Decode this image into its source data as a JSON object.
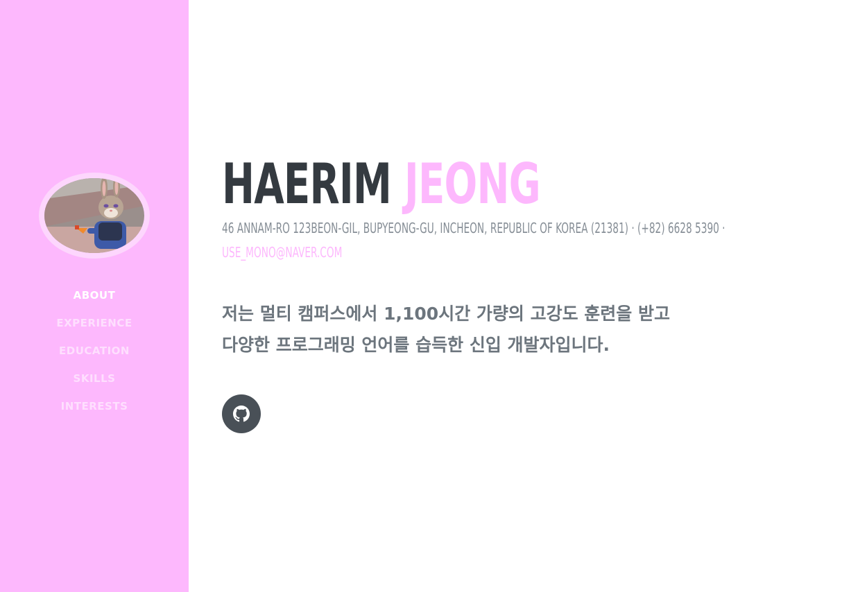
{
  "sidebar": {
    "bg_color": "#fdb8fd",
    "avatar_alt": "profile-photo",
    "nav": [
      {
        "label": "ABOUT",
        "active": true
      },
      {
        "label": "EXPERIENCE",
        "active": false
      },
      {
        "label": "EDUCATION",
        "active": false
      },
      {
        "label": "SKILLS",
        "active": false
      },
      {
        "label": "INTERESTS",
        "active": false
      }
    ]
  },
  "main": {
    "first_name": "HAERIM",
    "last_name": "JEONG",
    "address": "46 ANNAM-RO 123BEON-GIL, BUPYEONG-GU, INCHEON, REPUBLIC OF KOREA (21381) · (+82) 6628 5390 ·",
    "email": "USE_MONO@NAVER.COM",
    "intro_line1": "저는 멀티 캠퍼스에서 1,100시간 가량의 고강도 훈련을 받고",
    "intro_line2": "다양한 프로그래밍 언어를 습득한 신입 개발자입니다.",
    "social": [
      {
        "icon": "github-icon"
      }
    ],
    "accent_color": "#fdb8fd",
    "heading_color": "#343a40"
  }
}
